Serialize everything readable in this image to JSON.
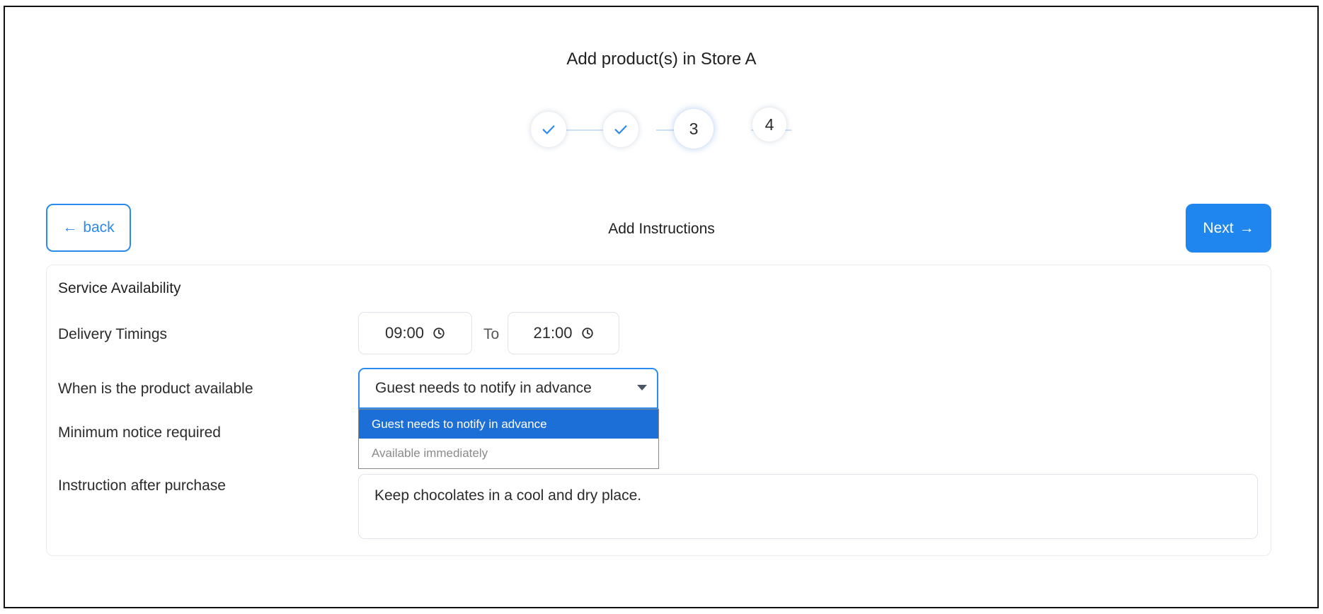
{
  "page": {
    "title": "Add product(s) in Store A",
    "section_title": "Add Instructions"
  },
  "stepper": {
    "steps": [
      {
        "label": "",
        "state": "done",
        "icon": "check-icon"
      },
      {
        "label": "",
        "state": "done",
        "icon": "check-icon"
      },
      {
        "label": "3",
        "state": "active"
      },
      {
        "label": "4",
        "state": "upcoming"
      }
    ]
  },
  "nav": {
    "back_label": "back",
    "back_icon": "arrow-left-icon",
    "next_label": "Next",
    "next_icon": "arrow-right-icon"
  },
  "form": {
    "heading": "Service Availability",
    "delivery_timings_label": "Delivery Timings",
    "time_from": "09:00",
    "time_to_label": "To",
    "time_to": "21:00",
    "availability_label": "When is the product available",
    "availability_selected": "Guest needs to notify in advance",
    "availability_options": [
      "Guest needs to notify in advance",
      "Available immediately"
    ],
    "min_notice_label": "Minimum notice required",
    "instruction_label": "Instruction after purchase",
    "instruction_value": "Keep chocolates in a cool and dry place."
  },
  "colors": {
    "accent": "#1e86ee",
    "selected_option": "#1d6fd8",
    "border": "#dfe4ea"
  }
}
